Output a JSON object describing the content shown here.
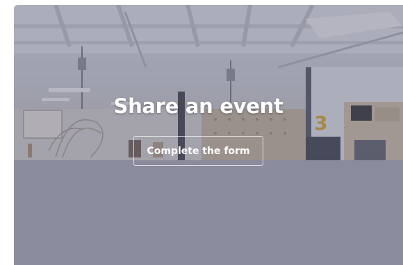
{
  "hero": {
    "title": "Share an event",
    "cta_label": "Complete the form"
  },
  "colors": {
    "overlay": "#5a5c78",
    "lower_panel": "#8a8b9c",
    "text": "#ffffff"
  }
}
